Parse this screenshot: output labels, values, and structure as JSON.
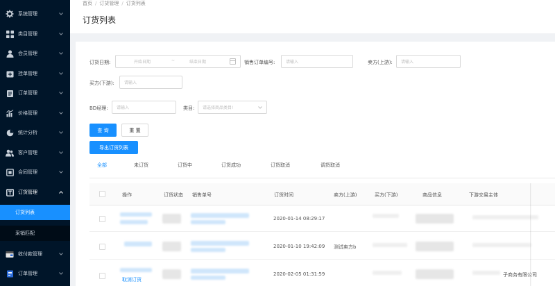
{
  "sidebar": {
    "items": [
      {
        "label": "系统管理",
        "icon": "gear-icon"
      },
      {
        "label": "类目管理",
        "icon": "grid-icon"
      },
      {
        "label": "会员管理",
        "icon": "user-icon"
      },
      {
        "label": "挂单管理",
        "icon": "plus-box-icon"
      },
      {
        "label": "订单管理",
        "icon": "clipboard-icon"
      },
      {
        "label": "价格管理",
        "icon": "bar-chart-icon"
      },
      {
        "label": "统计分析",
        "icon": "pie-chart-icon"
      },
      {
        "label": "客户管理",
        "icon": "users-icon"
      },
      {
        "label": "合同管理",
        "icon": "contract-icon"
      },
      {
        "label": "订货管理",
        "icon": "order-goods-icon"
      }
    ],
    "submenu": [
      {
        "label": "订货列表",
        "active": true
      },
      {
        "label": "采销匹配",
        "active": false
      }
    ],
    "bottom_items": [
      {
        "label": "收付款管理",
        "icon": "wallet-icon"
      },
      {
        "label": "订单管理",
        "icon": "doc-icon"
      }
    ]
  },
  "breadcrumb": [
    "首页",
    "订货管理",
    "订货列表"
  ],
  "page_title": "订货列表",
  "filters": {
    "order_date_label": "订货日期:",
    "start_placeholder": "开始日期",
    "range_sep": "~",
    "end_placeholder": "结束日期",
    "sales_no_label": "销售订单编号:",
    "sales_no_placeholder": "请输入",
    "seller_label": "卖方(上游):",
    "seller_placeholder": "请输入",
    "buyer_label": "买方(下游):",
    "buyer_placeholder": "请输入",
    "bd_label": "BD经理:",
    "bd_placeholder": "请输入",
    "category_label": "类目:",
    "category_placeholder": "请选择商品类目!"
  },
  "buttons": {
    "query": "查 询",
    "reset": "重 置",
    "export": "导出订货列表"
  },
  "tabs": [
    "全部",
    "未订货",
    "订货中",
    "订货成功",
    "订货取消",
    "调货取消"
  ],
  "table": {
    "columns": [
      "操作",
      "订货状态",
      "销售单号",
      "订货时间",
      "卖方(上游)",
      "买方(下游)",
      "商品信息",
      "下游交易主体"
    ],
    "rows": [
      {
        "time": "2020-01-14 08:29:17",
        "seller": "",
        "action": "",
        "subject": ""
      },
      {
        "time": "2020-01-10 19:42:09",
        "seller": "测试卖方b",
        "action": "",
        "subject": ""
      },
      {
        "time": "2020-02-05 01:31:59",
        "seller": "",
        "action": "取消订货",
        "subject": "子商务有限公司"
      }
    ]
  },
  "colors": {
    "sidebar_bg": "#001529",
    "accent": "#1890ff"
  }
}
